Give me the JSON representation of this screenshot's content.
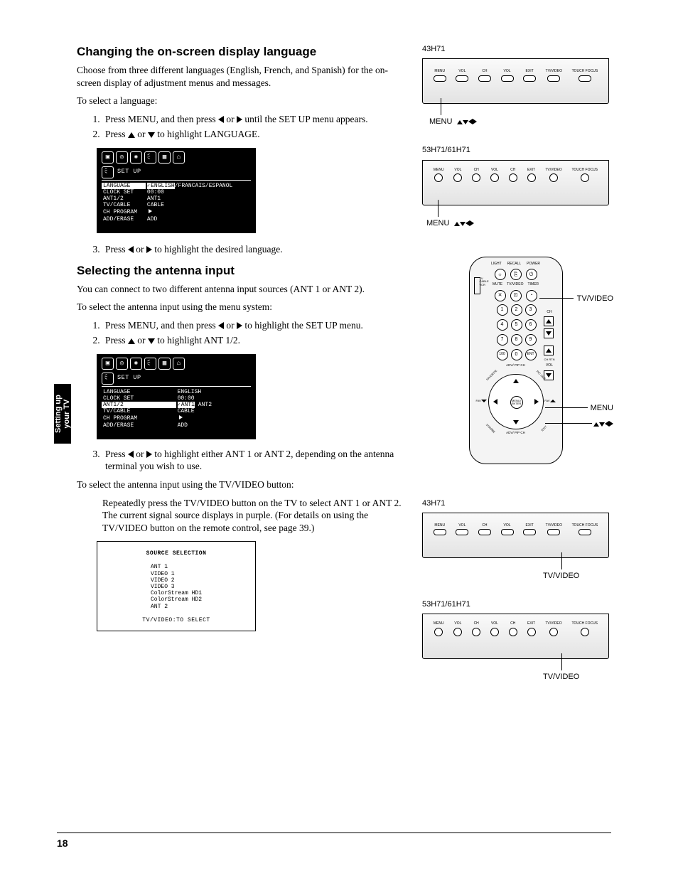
{
  "page_number": "18",
  "side_tab": {
    "line1": "Setting up",
    "line2": "your TV"
  },
  "section1": {
    "heading": "Changing the on-screen display language",
    "intro": "Choose from three different languages (English, French, and Spanish) for the on-screen display of adjustment menus and messages.",
    "lead": "To select a language:",
    "step1a": "Press MENU, and then press ",
    "step1b": " or ",
    "step1c": " until the SET UP menu appears.",
    "step2a": "Press ",
    "step2b": " or ",
    "step2c": " to highlight LANGUAGE.",
    "step3a": "Press ",
    "step3b": " or ",
    "step3c": " to highlight the desired language."
  },
  "osd1": {
    "title": "SET  UP",
    "rows": [
      {
        "k": "LANGUAGE",
        "v": "ENGLISH",
        "vextra": "/FRANCAIS/ESPANOL",
        "hl_k": true,
        "hl_v": true,
        "check": true
      },
      {
        "k": "CLOCK SET",
        "v": "00:00"
      },
      {
        "k": "ANT1/2",
        "v": "ANT1"
      },
      {
        "k": "TV/CABLE",
        "v": "CABLE"
      },
      {
        "k": "CH PROGRAM",
        "v": "",
        "arrow": true
      },
      {
        "k": "ADD/ERASE",
        "v": "ADD"
      }
    ]
  },
  "section2": {
    "heading": "Selecting the antenna input",
    "intro": "You can connect to two different antenna input sources (ANT 1 or ANT 2).",
    "lead_menu": "To select the antenna input using the menu system:",
    "step1a": "Press MENU, and then press ",
    "step1b": " or ",
    "step1c": " to highlight the SET UP menu.",
    "step2a": "Press ",
    "step2b": " or ",
    "step2c": " to highlight ANT 1/2.",
    "step3a": "Press ",
    "step3b": " or ",
    "step3c": " to highlight either ANT 1 or ANT 2, depending on the antenna terminal you wish to use.",
    "lead_btn": "To select the antenna input using the TV/VIDEO button:",
    "btn_para": "Repeatedly press the TV/VIDEO button on the TV to select ANT 1 or ANT 2. The current signal source displays in purple. (For details on using the TV/VIDEO button on the remote control, see page 39.)"
  },
  "osd2": {
    "title": "SET  UP",
    "rows": [
      {
        "k": "LANGUAGE",
        "v": "ENGLISH"
      },
      {
        "k": "CLOCK SET",
        "v": "00:00"
      },
      {
        "k": "ANT1/2",
        "v": "ANT1",
        "vextra": " ANT2",
        "hl_k": true,
        "hl_v": true,
        "check": true
      },
      {
        "k": "TV/CABLE",
        "v": "CABLE"
      },
      {
        "k": "CH PROGRAM",
        "v": "",
        "arrow": true
      },
      {
        "k": "ADD/ERASE",
        "v": "ADD"
      }
    ]
  },
  "osd_src": {
    "title": "SOURCE SELECTION",
    "items": [
      "ANT 1",
      "VIDEO 1",
      "VIDEO 2",
      "VIDEO 3",
      "ColorStream HD1",
      "ColorStream HD2",
      "ANT 2"
    ],
    "footer": "TV/VIDEO:TO SELECT"
  },
  "panels": {
    "model_a": "43H71",
    "model_b": "53H71/61H71",
    "buttons_a": [
      "MENU",
      "VOL",
      "CH",
      "VOL",
      "EXIT",
      "TV/VIDEO",
      "TOUCH FOCUS"
    ],
    "buttons_b": [
      "MENU",
      "VOL",
      "CH",
      "VOL",
      "CH",
      "EXIT",
      "TV/VIDEO",
      "TOUCH FOCUS"
    ],
    "callout_menu": "MENU",
    "callout_tvvideo": "TV/VIDEO"
  },
  "remote": {
    "top_labels": [
      "LIGHT",
      "RECALL",
      "POWER"
    ],
    "row2_labels": [
      "MUTE",
      "TV/VIDEO",
      "TIMER"
    ],
    "switch_labels": [
      "TV",
      "CABLE",
      "VCR"
    ],
    "numbers": [
      "1",
      "2",
      "3",
      "4",
      "5",
      "6",
      "7",
      "8",
      "9",
      "100",
      "0",
      "ENT"
    ],
    "side_labels_ch": "CH",
    "side_labels_vol": "VOL",
    "side_chrtn": "CH RTN",
    "dpad_center": "MENU/\nENTER",
    "dpad_top": "ADV/\nPIP CH",
    "dpad_bottom": "ADV/\nPIP CH",
    "dpad_left": "FAV",
    "dpad_right": "FAV",
    "dpad_corners": [
      "FAVORITE",
      "PIC SIZE",
      "STROBE",
      "EXIT"
    ],
    "callout_tvvideo": "TV/VIDEO",
    "callout_menu": "MENU"
  }
}
